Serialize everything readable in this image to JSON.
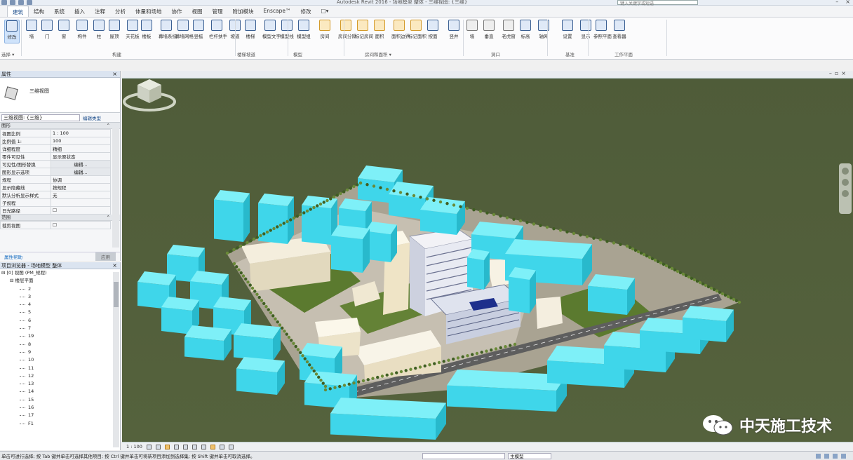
{
  "titlebar": {
    "title": "Autodesk Revit 2016 - 场地模型 整体 - 三维视图: {三维}",
    "search_placeholder": "键入关键字或短语"
  },
  "tabs": [
    "建筑",
    "结构",
    "系统",
    "插入",
    "注释",
    "分析",
    "体量和场地",
    "协作",
    "视图",
    "管理",
    "附加模块",
    "Enscape™",
    "修改",
    "□▾"
  ],
  "active_tab": "建筑",
  "ribbon": {
    "buttons": [
      {
        "label": "修改",
        "icon": "cursor-icon"
      },
      {
        "label": "墙",
        "icon": "wall-icon"
      },
      {
        "label": "门",
        "icon": "door-icon"
      },
      {
        "label": "窗",
        "icon": "window-icon"
      },
      {
        "label": "构件",
        "icon": "component-icon"
      },
      {
        "label": "柱",
        "icon": "column-icon"
      },
      {
        "label": "屋顶",
        "icon": "roof-icon"
      },
      {
        "label": "天花板",
        "icon": "ceiling-icon"
      },
      {
        "label": "楼板",
        "icon": "floor-icon"
      },
      {
        "label": "幕墙系统",
        "icon": "curtain-system-icon"
      },
      {
        "label": "幕墙网格",
        "icon": "curtain-grid-icon"
      },
      {
        "label": "竖梃",
        "icon": "mullion-icon"
      },
      {
        "label": "栏杆扶手",
        "icon": "railing-icon"
      },
      {
        "label": "坡道",
        "icon": "ramp-icon"
      },
      {
        "label": "楼梯",
        "icon": "stair-icon"
      },
      {
        "label": "模型文字",
        "icon": "model-text-icon"
      },
      {
        "label": "模型线",
        "icon": "model-line-icon"
      },
      {
        "label": "模型组",
        "icon": "model-group-icon"
      },
      {
        "label": "房间",
        "icon": "room-icon"
      },
      {
        "label": "房间分隔",
        "icon": "room-separator-icon"
      },
      {
        "label": "标记房间",
        "icon": "tag-room-icon"
      },
      {
        "label": "面积",
        "icon": "area-icon"
      },
      {
        "label": "面积边界",
        "icon": "area-boundary-icon"
      },
      {
        "label": "标记面积",
        "icon": "tag-area-icon"
      },
      {
        "label": "按面",
        "icon": "by-face-icon"
      },
      {
        "label": "竖井",
        "icon": "shaft-icon"
      },
      {
        "label": "墙",
        "icon": "wall-opening-icon"
      },
      {
        "label": "垂直",
        "icon": "vertical-icon"
      },
      {
        "label": "老虎窗",
        "icon": "dormer-icon"
      },
      {
        "label": "标高",
        "icon": "level-icon"
      },
      {
        "label": "轴网",
        "icon": "grid-icon"
      },
      {
        "label": "设置",
        "icon": "set-icon"
      },
      {
        "label": "显示",
        "icon": "show-icon"
      },
      {
        "label": "参照平面",
        "icon": "ref-plane-icon"
      },
      {
        "label": "查看器",
        "icon": "viewer-icon"
      }
    ],
    "panels": [
      "选择 ▾",
      "构建",
      "楼梯坡道",
      "模型",
      "房间和面积 ▾",
      "洞口",
      "基准",
      "工作平面"
    ]
  },
  "properties": {
    "title": "属性",
    "type_name": "三维视图",
    "view_selector": "三维视图: {三维}",
    "edit_type": "编辑类型",
    "section_graphics": "图形",
    "rows": [
      {
        "k": "视图比例",
        "v": "1 : 100"
      },
      {
        "k": "比例值 1:",
        "v": "100"
      },
      {
        "k": "详细程度",
        "v": "精细"
      },
      {
        "k": "零件可见性",
        "v": "显示原状态"
      },
      {
        "k": "可见性/图形替换",
        "v": "编辑..."
      },
      {
        "k": "图形显示选项",
        "v": "编辑..."
      },
      {
        "k": "规程",
        "v": "协调"
      },
      {
        "k": "显示隐藏线",
        "v": "按规程"
      },
      {
        "k": "默认分析显示样式",
        "v": "无"
      },
      {
        "k": "子规程",
        "v": ""
      },
      {
        "k": "日光路径",
        "v": "☐"
      }
    ],
    "section_extents": "范围",
    "extents_rows": [
      {
        "k": "裁剪视图",
        "v": "☐"
      }
    ],
    "help": "属性帮助",
    "apply": "应用"
  },
  "browser": {
    "title": "项目浏览器 - 场地模型 整体",
    "root": "[0] 视图 (PM_规程)",
    "group": "楼层平面",
    "levels": [
      "2",
      "3",
      "4",
      "5",
      "6",
      "7",
      "19",
      "8",
      "9",
      "10",
      "11",
      "12",
      "13",
      "14",
      "15",
      "16",
      "17",
      "F1"
    ]
  },
  "viewbar": {
    "scale": "1 : 100"
  },
  "status": {
    "message": "单击可进行选择; 按 Tab 键并单击可选择其他项目; 按 Ctrl 键并单击可将新项目添加到选择集; 按 Shift 键并单击可取消选择。",
    "model": "主模型"
  },
  "watermark": "中天施工技术",
  "colors": {
    "ground": "#4f5d3a",
    "site": "#b9b3a6",
    "cyan": "#45e4f2",
    "cyan_dark": "#26b5c9",
    "road": "#5e5e5e"
  }
}
